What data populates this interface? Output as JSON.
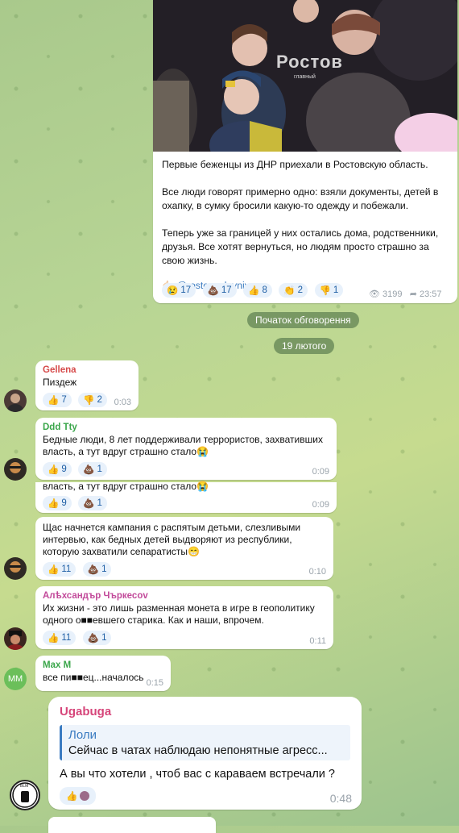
{
  "post": {
    "watermark": "Ростов",
    "watermark_sub": "главный",
    "paragraph1": "Первые беженцы из ДНР приехали в Ростовскую область.",
    "paragraph2": "Все люди говорят примерно одно: взяли документы, детей в охапку, в сумку бросили какую-то одежду и побежали.",
    "paragraph3": "Теперь уже за границей у них остались дома, родственники, друзья. Все хотят вернуться, но людям просто страшно за свою жизнь.",
    "source_link": "@rostov_glavniy",
    "reactions": [
      {
        "icon": "crying-face",
        "count": "17"
      },
      {
        "icon": "poop",
        "count": "17"
      },
      {
        "icon": "thumbs-up",
        "count": "8"
      },
      {
        "icon": "clap",
        "count": "2"
      },
      {
        "icon": "thumbs-down",
        "count": "1"
      }
    ],
    "views": "3199",
    "time": "23:57"
  },
  "pills": {
    "discussion_start": "Початок обговорення",
    "date": "19 лютого"
  },
  "messages": [
    {
      "name": "Gellena",
      "name_color": "#d64a4a",
      "text": "Пиздеж",
      "reactions": [
        {
          "icon": "thumbs-up",
          "count": "7"
        },
        {
          "icon": "thumbs-down",
          "count": "2"
        }
      ],
      "time": "0:03"
    },
    {
      "name": "Ddd Tty",
      "name_color": "#3aa64a",
      "text": "Бедные люди, 8 лет поддерживали террористов, захвативших власть, а тут вдруг страшно стало😭",
      "reactions": [
        {
          "icon": "thumbs-up",
          "count": "9"
        },
        {
          "icon": "poop",
          "count": "1"
        }
      ],
      "time": "0:09"
    },
    {
      "fragment_text": "власть, а тут вдруг страшно стало😭",
      "reactions": [
        {
          "icon": "thumbs-up",
          "count": "9"
        },
        {
          "icon": "poop",
          "count": "1"
        }
      ],
      "time": "0:09"
    },
    {
      "text": "Щас начнется кампания с распятым детьми, слезливыми интервью, как  бедных детей выдворяют из республики, которую захватили сепаратисты😁",
      "reactions": [
        {
          "icon": "thumbs-up",
          "count": "11"
        },
        {
          "icon": "poop",
          "count": "1"
        }
      ],
      "time": "0:10"
    },
    {
      "name": "Алѣхсандър Чъркесоv",
      "name_color": "#c24a9a",
      "text": "Их жизни - это лишь разменная монета в игре в геополитику одного о■■евшего старика. Как и наши, впрочем.",
      "reactions": [
        {
          "icon": "thumbs-up",
          "count": "11"
        },
        {
          "icon": "poop",
          "count": "1"
        }
      ],
      "time": "0:11"
    },
    {
      "name": "Max M",
      "name_color": "#3aa64a",
      "avatar_initials": "MM",
      "text": "все пи■■ец...началось",
      "time": "0:15"
    },
    {
      "name": "Ugabuga",
      "name_color": "#d6457a",
      "reply_name": "Лоли",
      "reply_text": "Сейчас в чатах наблюдаю непонятные агресс...",
      "text": "А вы что хотели , чтоб вас с караваем встречали ?",
      "time": "0:48",
      "avatar_label": "BLM"
    }
  ]
}
